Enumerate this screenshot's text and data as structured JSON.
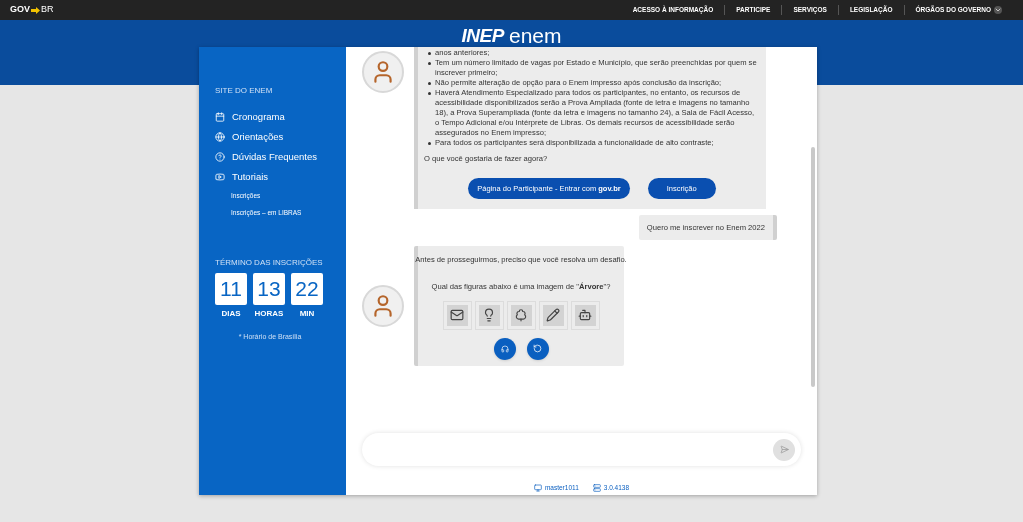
{
  "gov_bar": {
    "logo_left": "GOV",
    "logo_right": "BR",
    "links": [
      "ACESSO À INFORMAÇÃO",
      "PARTICIPE",
      "SERVIÇOS",
      "LEGISLAÇÃO",
      "ÓRGÃOS DO GOVERNO"
    ]
  },
  "header": {
    "logo_a": "INEP",
    "logo_b": "enem"
  },
  "sidebar": {
    "heading": "SITE DO ENEM",
    "items": [
      {
        "label": "Cronograma"
      },
      {
        "label": "Orientações"
      },
      {
        "label": "Dúvidas Frequentes"
      },
      {
        "label": "Tutoriais",
        "children": [
          {
            "label": "Inscrições"
          },
          {
            "label": "Inscrições – em LIBRAS"
          }
        ]
      }
    ],
    "countdown": {
      "title": "TÉRMINO DAS INSCRIÇÕES",
      "units": [
        {
          "value": "11",
          "label": "DIAS"
        },
        {
          "value": "13",
          "label": "HORAS"
        },
        {
          "value": "22",
          "label": "MIN"
        }
      ],
      "note": "* Horário de Brasília"
    }
  },
  "chat": {
    "messages": [
      {
        "kind": "bot_info",
        "bullets": [
          "anos anteriores;",
          "Tem um número limitado de vagas por Estado e Município, que serão preenchidas por quem se inscrever primeiro;",
          "Não permite alteração de opção para o Enem impresso após conclusão da inscrição;",
          "Haverá Atendimento Especializado para todos os participantes, no entanto, os recursos de acessibilidade disponibilizados serão a Prova Ampliada (fonte de letra e imagens no tamanho 18), a Prova Superampliada (fonte da letra e imagens no tamanho 24), a Sala de Fácil Acesso, o Tempo Adicional e/ou Intérprete de Libras. Os demais recursos de acessibilidade serão assegurados no Enem impresso;",
          "Para todos os participantes será disponibilizada a funcionalidade de alto contraste;"
        ],
        "question": "O que você gostaria de fazer agora?",
        "buttons": [
          "Página do Participante - Entrar com **gov.br**",
          "Inscrição"
        ]
      },
      {
        "kind": "user",
        "text": "Quero me inscrever no Enem 2022"
      },
      {
        "kind": "captcha",
        "intro": "Antes de prosseguirmos, preciso que você resolva um desafio.",
        "question": "Qual das figuras abaixo é uma imagem de \"**Árvore**\"?"
      }
    ]
  },
  "footer": {
    "host": "master1011",
    "version": "3.0.4138"
  }
}
